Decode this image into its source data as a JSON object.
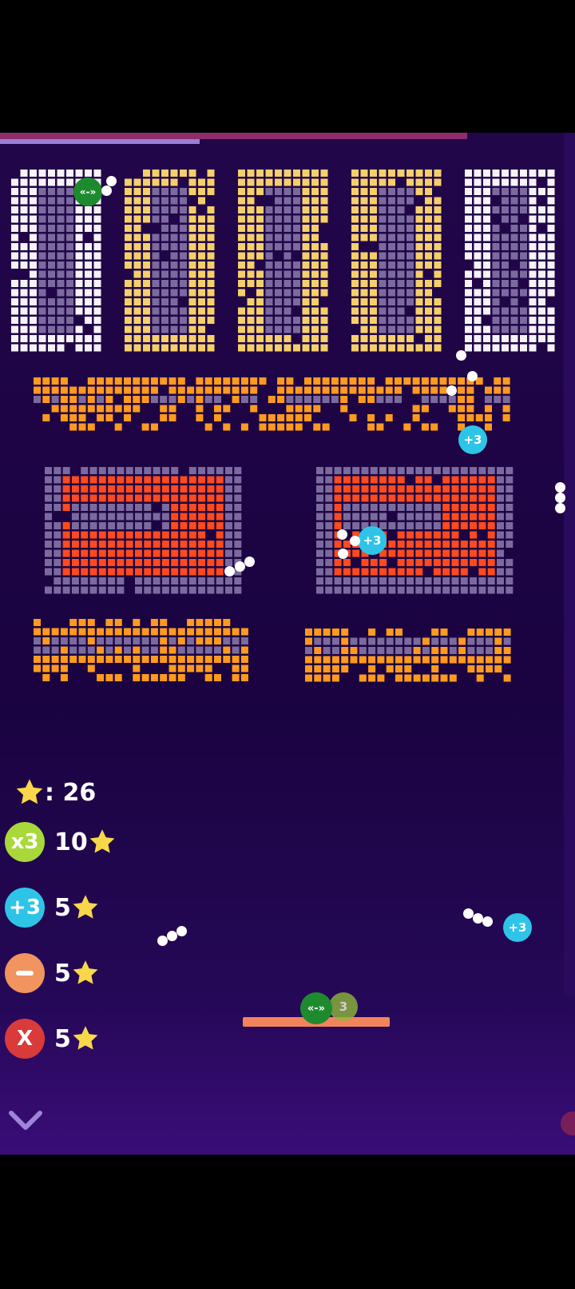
{
  "hud": {
    "stars_label": ": 26",
    "powerups": [
      {
        "id": "multiply",
        "label": "x3",
        "cost": "10",
        "color": "#a8d83a"
      },
      {
        "id": "plus",
        "label": "+3",
        "cost": "5",
        "color": "#2ec4e8"
      },
      {
        "id": "shrink",
        "label": "—",
        "cost": "5",
        "color": "#f2945f"
      },
      {
        "id": "clear",
        "label": "X",
        "cost": "5",
        "color": "#d93a3a"
      }
    ]
  },
  "tokens": {
    "plus_label": "+3",
    "expand_label": "«-»",
    "paddle_ghost_label": "3"
  },
  "colors": {
    "white_brick": "#f5f2f8",
    "yellow_brick": "#f5cf6a",
    "orange_brick": "#ff9a1f",
    "red_brick": "#ff4a1e",
    "gray_brick": "#7b6a9e",
    "paddle": "#f2845c",
    "star": "#f8d84a"
  }
}
